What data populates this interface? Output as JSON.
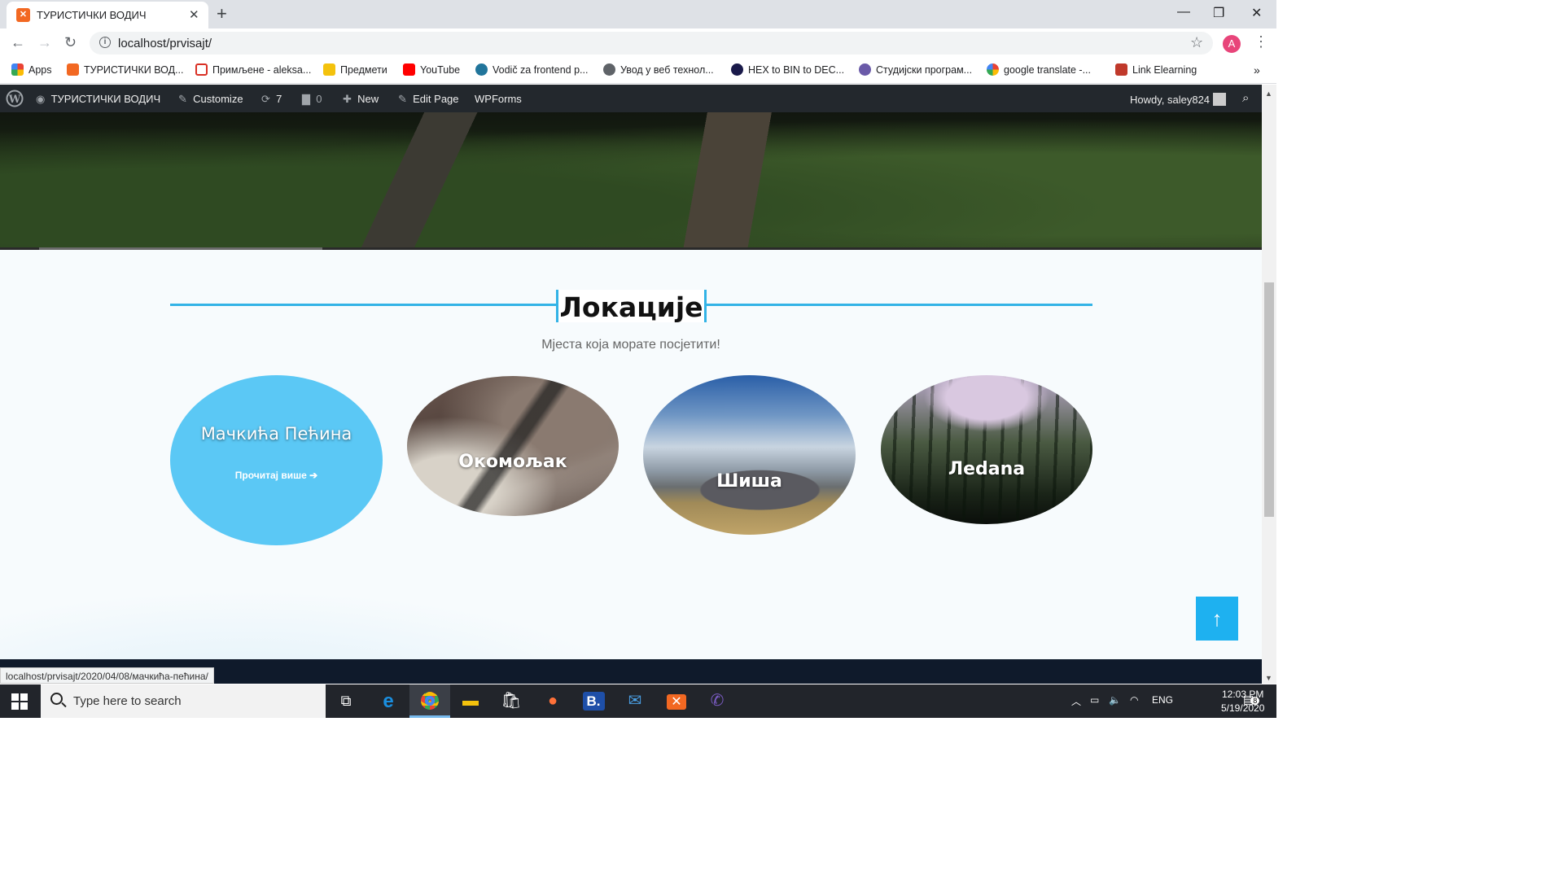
{
  "browser": {
    "tab_title": "ТУРИСТИЧКИ ВОДИЧ",
    "url": "localhost/prvisajt/",
    "profile_initial": "A",
    "bookmarks": [
      {
        "label": "Apps",
        "icon": "apps-grid-icon"
      },
      {
        "label": "ТУРИСТИЧКИ ВОД...",
        "icon": "xampp-icon"
      },
      {
        "label": "Примљене - aleksa...",
        "icon": "gmail-icon"
      },
      {
        "label": "Предмети",
        "icon": "folder-icon"
      },
      {
        "label": "YouTube",
        "icon": "youtube-icon"
      },
      {
        "label": "Vodič za frontend p...",
        "icon": "wordpress-icon"
      },
      {
        "label": "Увод у веб технол...",
        "icon": "globe-icon"
      },
      {
        "label": "HEX to BIN to DEC...",
        "icon": "hex-icon"
      },
      {
        "label": "Студијски програм...",
        "icon": "university-icon"
      },
      {
        "label": "google translate -...",
        "icon": "google-icon"
      },
      {
        "label": "Link Elearning",
        "icon": "elearning-icon"
      }
    ],
    "status_url": "localhost/prvisajt/2020/04/08/мачкића-пећина/"
  },
  "wp_admin_bar": {
    "site_name": "ТУРИСТИЧКИ ВОДИЧ",
    "customize": "Customize",
    "updates_count": "7",
    "comments_count": "0",
    "new": "New",
    "edit_page": "Edit Page",
    "wpforms": "WPForms",
    "howdy": "Howdy, saley824"
  },
  "section": {
    "title": "Локације",
    "subtitle": "Мјеста која морате посјетити!",
    "locations": [
      {
        "name": "Мачкића Пећина",
        "read_more": "Прочитај више",
        "hovered": true
      },
      {
        "name": "Окомољак"
      },
      {
        "name": "Шиша"
      },
      {
        "name": "Леdana"
      }
    ],
    "colors": {
      "accent": "#33b3e6",
      "hover_fill": "#5bc8f5",
      "to_top": "#1eb1f0"
    }
  },
  "taskbar": {
    "search_placeholder": "Type here to search",
    "language": "ENG",
    "time": "12:03 PM",
    "date": "5/19/2020",
    "notifications": "8"
  }
}
